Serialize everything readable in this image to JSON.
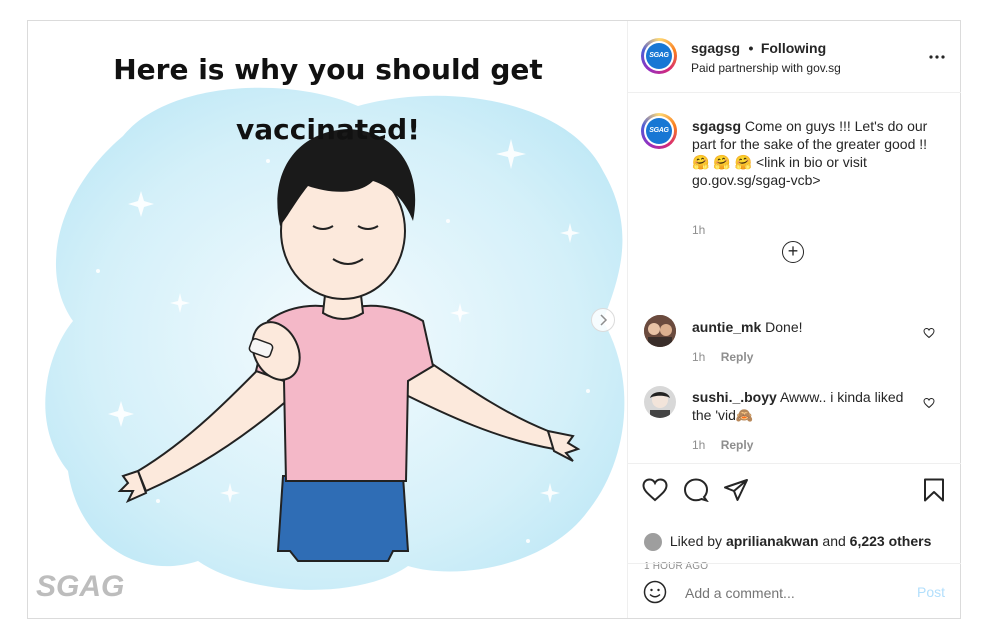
{
  "post": {
    "image_title_line1": "Here is why you should get",
    "image_title_line2": "vaccinated!",
    "watermark": "SGAG",
    "account": {
      "username": "sgagsg",
      "separator": "•",
      "follow_status": "Following",
      "partnership": "Paid partnership with gov.sg",
      "avatar_text": "SGAG"
    },
    "caption": {
      "username": "sgagsg",
      "text_part1": "Come on guys !!! Let's do our part for the sake of the greater good !!",
      "emojis": "🤗 🤗 🤗",
      "text_part2": "<link in bio or visit go.gov.sg/sgag-vcb>",
      "time": "1h"
    },
    "load_more_label": "+",
    "comments": [
      {
        "username": "auntie_mk",
        "text": "Done!",
        "time": "1h",
        "reply": "Reply"
      },
      {
        "username": "sushi._.boyy",
        "text": "Awww.. i kinda liked the 'vid",
        "emoji": "🙈",
        "time": "1h",
        "reply": "Reply"
      }
    ],
    "likes": {
      "prefix": "Liked by",
      "user": "aprilianakwan",
      "and": "and",
      "count": "6,223 others"
    },
    "timestamp": "1 HOUR AGO",
    "add_comment": {
      "placeholder": "Add a comment...",
      "post_label": "Post"
    },
    "colors": {
      "accent_blue": "#0095f6",
      "post_disabled": "#b2dffc",
      "shirt_pink": "#f4b8c8",
      "jeans_blue": "#2f6db5",
      "bg_cloud": "#cdeef8"
    },
    "icons": [
      "more-icon",
      "heart-icon",
      "comment-icon",
      "share-icon",
      "bookmark-icon",
      "emoji-icon",
      "next-arrow-icon",
      "plus-icon"
    ]
  }
}
